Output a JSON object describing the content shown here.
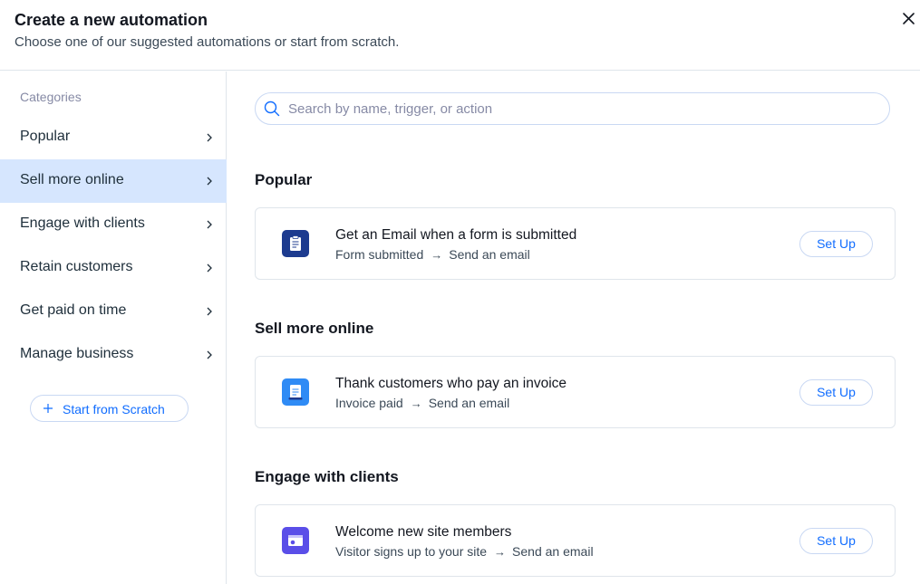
{
  "header": {
    "title": "Create a new automation",
    "subtitle": "Choose one of our suggested automations or start from scratch.",
    "close_icon": "close-icon"
  },
  "sidebar": {
    "heading": "Categories",
    "items": [
      {
        "label": "Popular",
        "active": false
      },
      {
        "label": "Sell more online",
        "active": true
      },
      {
        "label": "Engage with clients",
        "active": false
      },
      {
        "label": "Retain customers",
        "active": false
      },
      {
        "label": "Get paid on time",
        "active": false
      },
      {
        "label": "Manage business",
        "active": false
      }
    ],
    "scratch_button": "Start from Scratch"
  },
  "search": {
    "value": "",
    "placeholder": "Search by name, trigger, or action"
  },
  "sections": [
    {
      "title": "Popular",
      "cards": [
        {
          "title": "Get an Email when a form is submitted",
          "trigger": "Form submitted",
          "action": "Send an email",
          "icon": "clipboard-form-icon",
          "icon_color": "#1d3b8f",
          "button": "Set Up"
        }
      ]
    },
    {
      "title": "Sell more online",
      "cards": [
        {
          "title": "Thank customers who pay an invoice",
          "trigger": "Invoice paid",
          "action": "Send an email",
          "icon": "invoice-icon",
          "icon_color": "#2f8bf5",
          "button": "Set Up"
        }
      ]
    },
    {
      "title": "Engage with clients",
      "cards": [
        {
          "title": "Welcome new site members",
          "trigger": "Visitor signs up to your site",
          "action": "Send an email",
          "icon": "site-member-icon",
          "icon_color": "#5a4ee8",
          "button": "Set Up"
        }
      ]
    }
  ],
  "colors": {
    "accent": "#116dff",
    "active_bg": "#d6e6fe",
    "border": "#dfe5eb"
  }
}
